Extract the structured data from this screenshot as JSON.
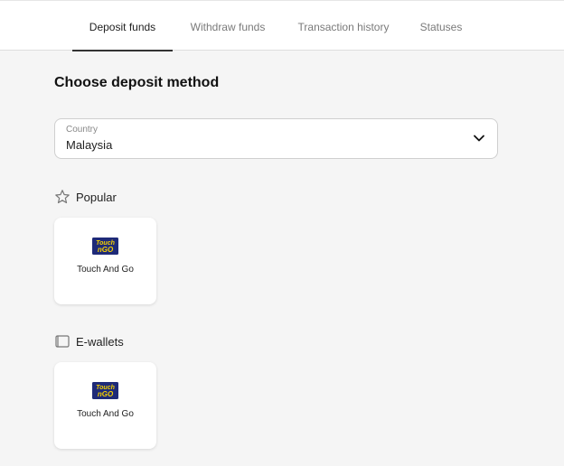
{
  "tabs": [
    {
      "label": "Deposit funds",
      "active": true
    },
    {
      "label": "Withdraw funds",
      "active": false
    },
    {
      "label": "Transaction history",
      "active": false
    },
    {
      "label": "Statuses",
      "active": false
    }
  ],
  "page": {
    "title": "Choose deposit method"
  },
  "country": {
    "label": "Country",
    "value": "Malaysia"
  },
  "sections": [
    {
      "title": "Popular",
      "icon": "star-icon",
      "methods": [
        {
          "name": "Touch And Go",
          "logo_text": [
            "Touch",
            "nGO"
          ]
        }
      ]
    },
    {
      "title": "E-wallets",
      "icon": "wallet-icon",
      "methods": [
        {
          "name": "Touch And Go",
          "logo_text": [
            "Touch",
            "nGO"
          ]
        }
      ]
    }
  ],
  "colors": {
    "background": "#f5f5f5",
    "card": "#ffffff",
    "logo_bg": "#1e2a78",
    "logo_text": "#f5d000"
  }
}
